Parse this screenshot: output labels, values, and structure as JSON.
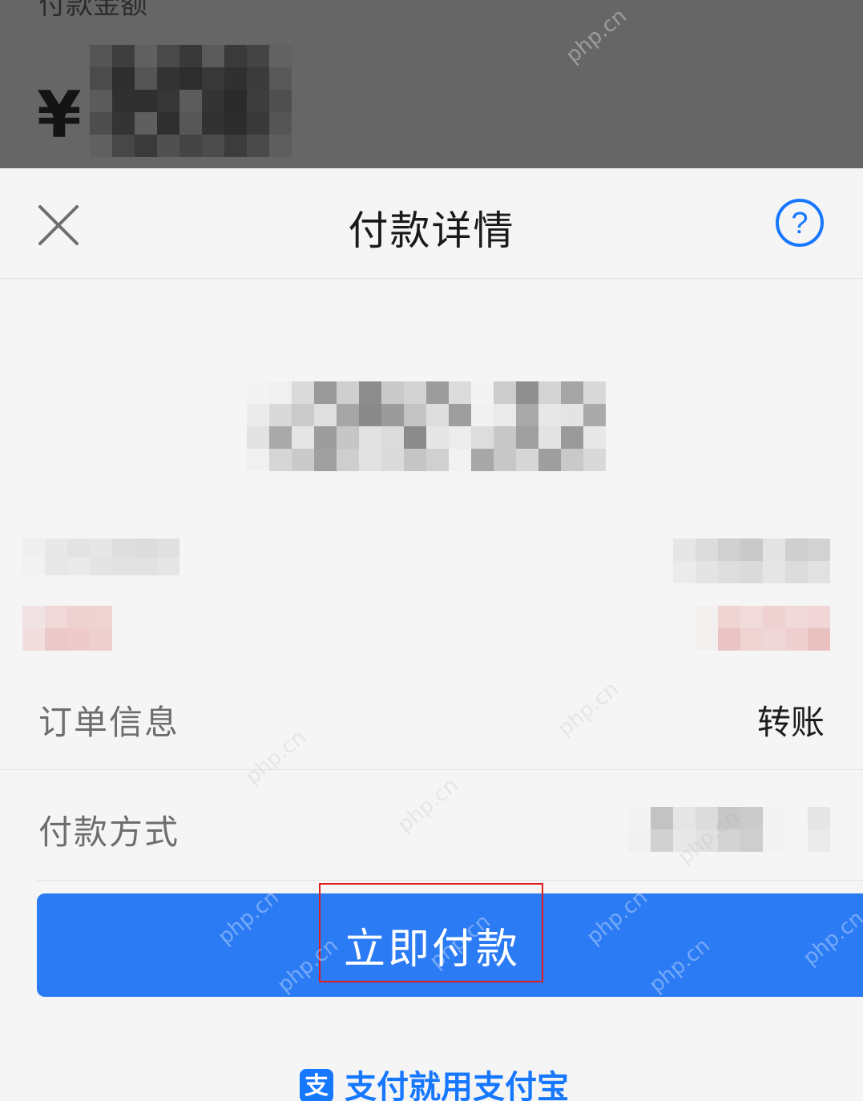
{
  "background": {
    "caption": "付款金额",
    "currency_symbol": "¥"
  },
  "sheet": {
    "title": "付款详情",
    "close_icon": "close-icon",
    "help_icon": "question-circle-icon"
  },
  "rows": {
    "order_info": {
      "label": "订单信息",
      "value": "转账"
    },
    "payment_method": {
      "label": "付款方式"
    }
  },
  "pay_button": {
    "label": "立即付款"
  },
  "footer": {
    "icon_glyph": "支",
    "text": "支付就用支付宝"
  },
  "watermark": "php.cn",
  "colors": {
    "accent": "#2b7bf4",
    "help": "#1677ff",
    "highlight": "#e01e1e",
    "overlay": "#666666"
  }
}
